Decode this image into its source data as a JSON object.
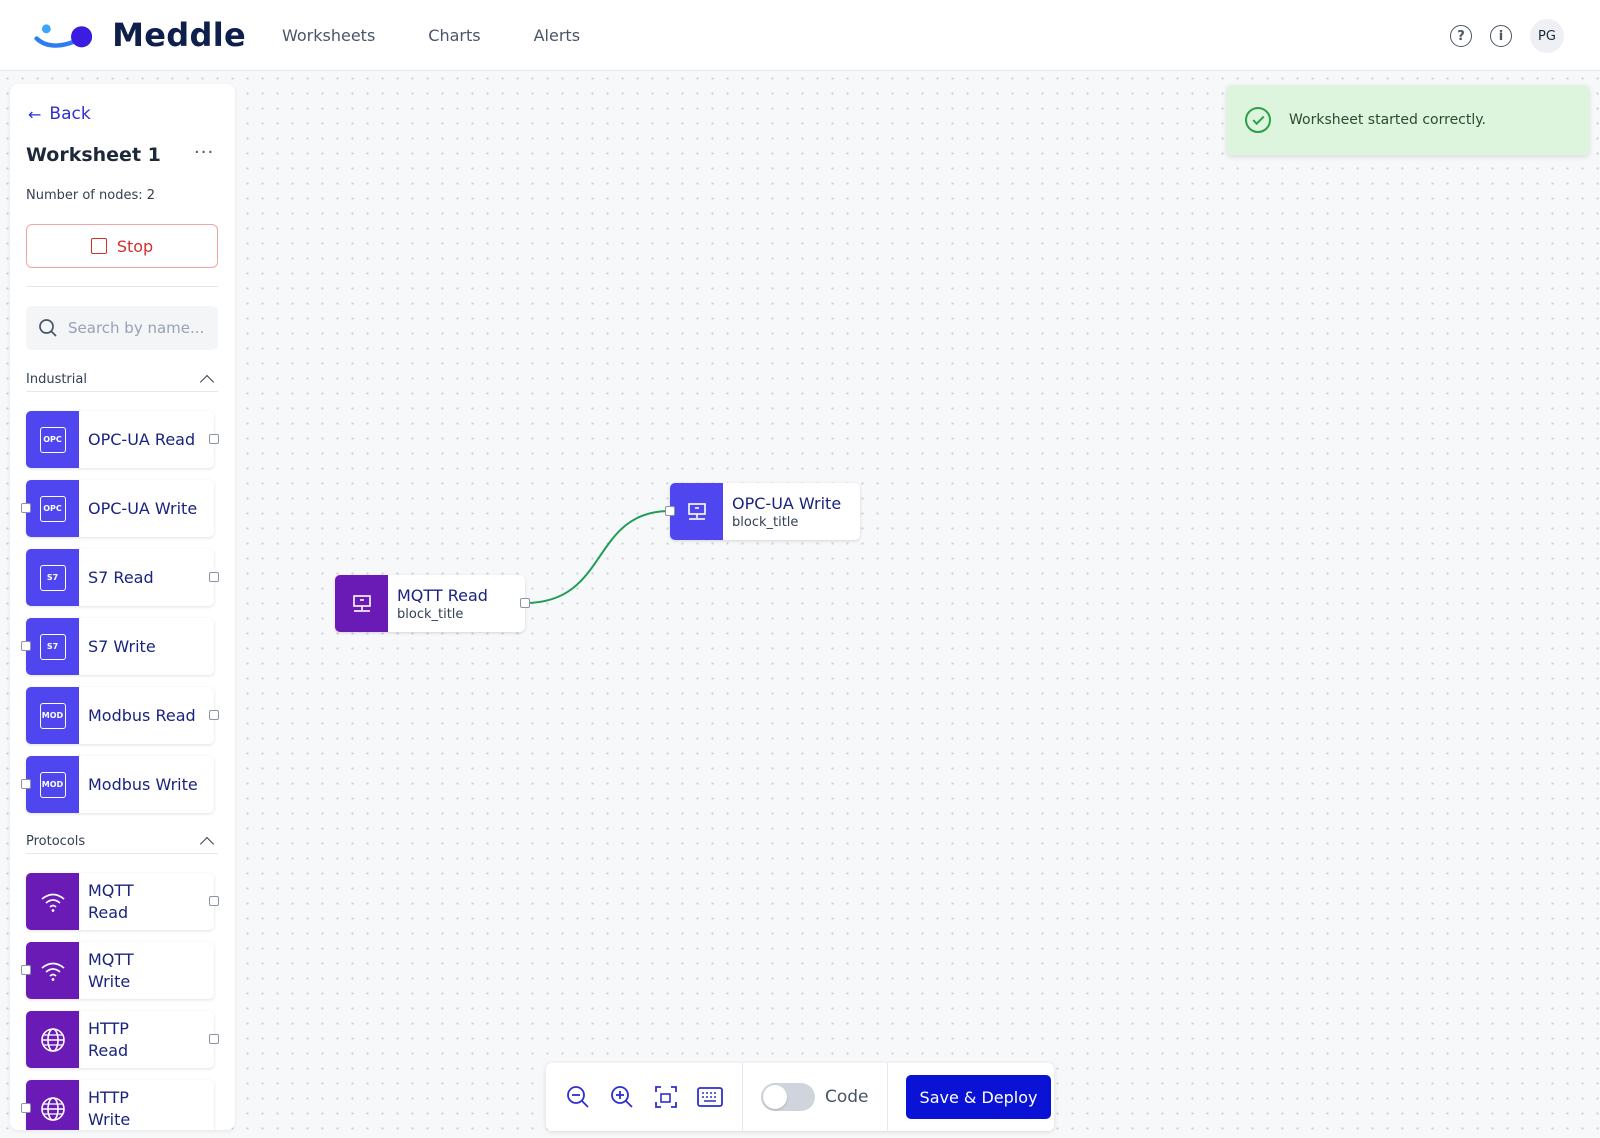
{
  "app": {
    "name": "Meddle"
  },
  "nav": [
    {
      "label": "Worksheets"
    },
    {
      "label": "Charts"
    },
    {
      "label": "Alerts"
    }
  ],
  "topbar": {
    "help_glyph": "?",
    "info_glyph": "i",
    "avatar_initials": "PG"
  },
  "sidebar": {
    "back_label": "Back",
    "worksheet_title": "Worksheet 1",
    "menu_glyph": "···",
    "nodes_count": "Number of nodes: 2",
    "stop_label": "Stop",
    "search_placeholder": "Search by name...",
    "sections": [
      {
        "title": "Industrial",
        "items": [
          {
            "label": "OPC-UA Read",
            "tag": "OPC"
          },
          {
            "label": "OPC-UA Write",
            "tag": "OPC"
          },
          {
            "label": "S7 Read",
            "tag": "S7"
          },
          {
            "label": "S7 Write",
            "tag": "S7"
          },
          {
            "label": "Modbus Read",
            "tag": "MOD"
          },
          {
            "label": "Modbus Write",
            "tag": "MOD"
          }
        ]
      },
      {
        "title": "Protocols",
        "items": [
          {
            "label": "MQTT Read",
            "icon": "wifi-icon"
          },
          {
            "label": "MQTT Write",
            "icon": "wifi-icon"
          },
          {
            "label": "HTTP Read",
            "icon": "globe-icon"
          },
          {
            "label": "HTTP Write",
            "icon": "globe-icon"
          }
        ]
      }
    ]
  },
  "flow": {
    "nodes": [
      {
        "title": "MQTT Read",
        "subtitle": "block_title",
        "icon": "network-node-icon"
      },
      {
        "title": "OPC-UA Write",
        "subtitle": "block_title",
        "icon": "network-node-icon"
      }
    ]
  },
  "toast": {
    "message": "Worksheet started correctly."
  },
  "toolbar": {
    "code_label": "Code",
    "code_enabled": false,
    "deploy_label": "Save & Deploy"
  },
  "colors": {
    "industrial": "#4f46f0",
    "protocols": "#6a1bb5",
    "primary": "#0a12d6",
    "success_bg": "#dcf5dc",
    "stop": "#d32f2f",
    "link": "#1f9d55"
  }
}
